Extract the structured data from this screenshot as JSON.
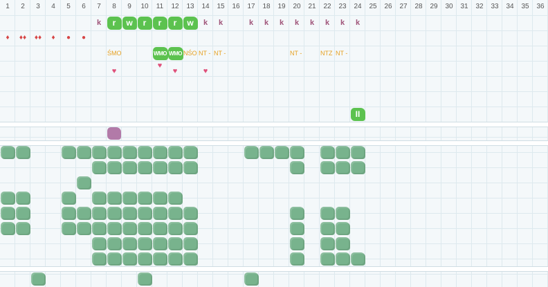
{
  "days": [
    "1",
    "2",
    "3",
    "4",
    "5",
    "6",
    "7",
    "8",
    "9",
    "10",
    "11",
    "12",
    "13",
    "14",
    "15",
    "16",
    "17",
    "18",
    "19",
    "20",
    "21",
    "22",
    "23",
    "24",
    "25",
    "26",
    "27",
    "28",
    "29",
    "30",
    "31",
    "32",
    "33",
    "34",
    "35",
    "36"
  ],
  "row_k": [
    {
      "day": 7,
      "text": "k"
    },
    {
      "day": 8,
      "text": "r",
      "style": "bright"
    },
    {
      "day": 9,
      "text": "w",
      "style": "bright"
    },
    {
      "day": 10,
      "text": "r",
      "style": "bright"
    },
    {
      "day": 11,
      "text": "r",
      "style": "bright"
    },
    {
      "day": 12,
      "text": "r",
      "style": "bright"
    },
    {
      "day": 13,
      "text": "w",
      "style": "bright"
    },
    {
      "day": 14,
      "text": "k"
    },
    {
      "day": 15,
      "text": "k"
    },
    {
      "day": 17,
      "text": "k"
    },
    {
      "day": 18,
      "text": "k"
    },
    {
      "day": 19,
      "text": "k"
    },
    {
      "day": 20,
      "text": "k"
    },
    {
      "day": 21,
      "text": "k"
    },
    {
      "day": 22,
      "text": "k"
    },
    {
      "day": 23,
      "text": "k"
    },
    {
      "day": 24,
      "text": "k"
    }
  ],
  "row_drops": [
    {
      "day": 1,
      "text": "♦"
    },
    {
      "day": 2,
      "text": "♦♦"
    },
    {
      "day": 3,
      "text": "♦♦"
    },
    {
      "day": 4,
      "text": "♦"
    },
    {
      "day": 5,
      "text": "●"
    },
    {
      "day": 6,
      "text": "●"
    }
  ],
  "row_codes": [
    {
      "day": 8,
      "text": "ŚMO"
    },
    {
      "day": 11,
      "text": "WMO",
      "style": "bright"
    },
    {
      "day": 12,
      "text": "WMO",
      "style": "bright"
    },
    {
      "day": 13,
      "text": "NŚO"
    },
    {
      "day": 14,
      "text": "NT -"
    },
    {
      "day": 15,
      "text": "NT -"
    },
    {
      "day": 20,
      "text": "NT -"
    },
    {
      "day": 22,
      "text": "NTZ"
    },
    {
      "day": 23,
      "text": "NT -"
    }
  ],
  "row_hearts": [
    {
      "day": 8,
      "text": "♥",
      "row": 0
    },
    {
      "day": 11,
      "text": "♥",
      "row": -0.4
    },
    {
      "day": 12,
      "text": "♥",
      "row": 0
    },
    {
      "day": 14,
      "text": "♥",
      "row": 0
    }
  ],
  "row_ii": {
    "day": 24,
    "text": "II"
  },
  "purple_day": 8,
  "green_rows": [
    [
      1,
      2,
      5,
      6,
      7,
      8,
      9,
      10,
      11,
      12,
      13,
      17,
      18,
      19,
      20,
      22,
      23,
      24
    ],
    [
      7,
      8,
      9,
      10,
      11,
      12,
      13,
      20,
      22,
      23,
      24
    ],
    [
      6
    ],
    [
      1,
      2,
      5,
      7,
      8,
      9,
      10,
      11,
      12
    ],
    [
      1,
      2,
      5,
      6,
      7,
      8,
      9,
      10,
      11,
      12,
      13,
      20,
      22,
      23
    ],
    [
      1,
      2,
      5,
      6,
      7,
      8,
      9,
      10,
      11,
      12,
      13,
      20,
      22,
      23
    ],
    [
      7,
      8,
      9,
      10,
      11,
      12,
      13,
      20,
      22,
      23
    ],
    [
      7,
      8,
      9,
      10,
      11,
      12,
      13,
      20,
      22,
      23,
      24
    ]
  ],
  "bottom_row": [
    3,
    10,
    17
  ],
  "colors": {
    "accent_green": "#5cc24f",
    "muted_green": "#78b38d",
    "purple": "#b27aa8",
    "orange": "#e6a020",
    "drop_red": "#d64545",
    "heart_pink": "#e0507a",
    "k_color": "#a0557a"
  }
}
